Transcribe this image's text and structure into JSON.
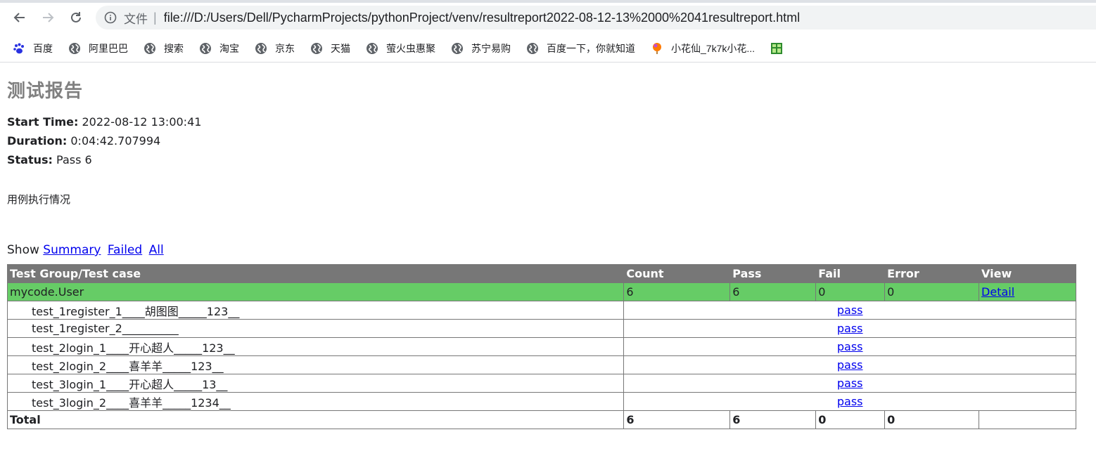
{
  "browser": {
    "page_label": "文件",
    "url": "file:///D:/Users/Dell/PycharmProjects/pythonProject/venv/resultreport2022-08-12-13%2000%2041resultreport.html",
    "bookmarks": [
      {
        "label": "百度",
        "icon": "baidu-paw-icon"
      },
      {
        "label": "阿里巴巴",
        "icon": "globe-icon"
      },
      {
        "label": "搜索",
        "icon": "globe-icon"
      },
      {
        "label": "淘宝",
        "icon": "globe-icon"
      },
      {
        "label": "京东",
        "icon": "globe-icon"
      },
      {
        "label": "天猫",
        "icon": "globe-icon"
      },
      {
        "label": "萤火虫惠聚",
        "icon": "globe-icon"
      },
      {
        "label": "苏宁易购",
        "icon": "globe-icon"
      },
      {
        "label": "百度一下，你就知道",
        "icon": "globe-icon"
      },
      {
        "label": "小花仙_7k7k小花...",
        "icon": "flower-balloon-icon"
      },
      {
        "label": "",
        "icon": "green-grid-icon"
      }
    ]
  },
  "report": {
    "title": "测试报告",
    "start_time_label": "Start Time:",
    "start_time": "2022-08-12 13:00:41",
    "duration_label": "Duration:",
    "duration": "0:04:42.707994",
    "status_label": "Status:",
    "status": "Pass 6",
    "description": "用例执行情况",
    "show_label": "Show",
    "show_links": [
      "Summary",
      "Failed",
      "All"
    ]
  },
  "table": {
    "headers": [
      "Test Group/Test case",
      "Count",
      "Pass",
      "Fail",
      "Error",
      "View"
    ],
    "group": {
      "name": "mycode.User",
      "count": "6",
      "pass": "6",
      "fail": "0",
      "error": "0",
      "view": "Detail"
    },
    "cases": [
      {
        "name": "test_1register_1____胡图图_____123__",
        "status": "pass"
      },
      {
        "name": "test_1register_2__________",
        "status": "pass"
      },
      {
        "name": "test_2login_1____开心超人_____123__",
        "status": "pass"
      },
      {
        "name": "test_2login_2____喜羊羊_____123__",
        "status": "pass"
      },
      {
        "name": "test_3login_1____开心超人_____13__",
        "status": "pass"
      },
      {
        "name": "test_3login_2____喜羊羊_____1234__",
        "status": "pass"
      }
    ],
    "total": {
      "label": "Total",
      "count": "6",
      "pass": "6",
      "fail": "0",
      "error": "0"
    }
  },
  "colors": {
    "header_bg": "#777777",
    "group_bg": "#66cc66",
    "link": "#0000ee",
    "title": "#808080"
  }
}
